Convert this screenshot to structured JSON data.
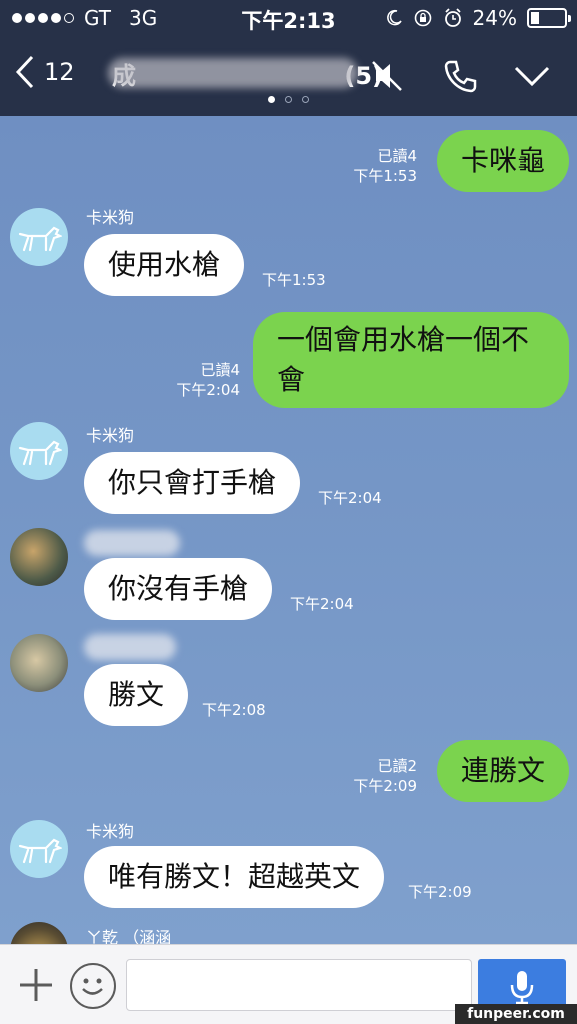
{
  "status_bar": {
    "carrier": "GT",
    "network": "3G",
    "time": "下午2:13",
    "battery": "24%"
  },
  "header": {
    "back_count": "12",
    "title_visible": "成",
    "title_suffix": "(5)"
  },
  "messages": [
    {
      "side": "me",
      "text": "卡咪龜",
      "read": "已讀4",
      "time": "下午1:53"
    },
    {
      "side": "them",
      "sender": "卡米狗",
      "text": "使用水槍",
      "time": "下午1:53"
    },
    {
      "side": "me",
      "text_line1": "一個會用水槍一個不",
      "text_line2": "會",
      "read": "已讀4",
      "time": "下午2:04"
    },
    {
      "side": "them",
      "sender": "卡米狗",
      "text": "你只會打手槍",
      "time": "下午2:04"
    },
    {
      "side": "them",
      "text": "你沒有手槍",
      "time": "下午2:04"
    },
    {
      "side": "them",
      "text": "勝文",
      "time": "下午2:08"
    },
    {
      "side": "me",
      "text": "連勝文",
      "read": "已讀2",
      "time": "下午2:09"
    },
    {
      "side": "them",
      "sender": "卡米狗",
      "text": "唯有勝文！超越英文",
      "time": "下午2:09"
    },
    {
      "side": "them",
      "sender": "ㄚ乾 （涵涵"
    }
  ],
  "watermark": "funpeer.com",
  "icons": [
    "back-chevron-icon",
    "mute-icon",
    "phone-icon",
    "chevron-down-icon",
    "plus-icon",
    "emoji-icon",
    "mic-icon",
    "moon-icon",
    "rotation-lock-icon",
    "alarm-icon"
  ],
  "colors": {
    "bar": "#273148",
    "my_bubble": "#7bd34e",
    "their_bubble": "#ffffff",
    "send_button": "#3c7de0"
  }
}
